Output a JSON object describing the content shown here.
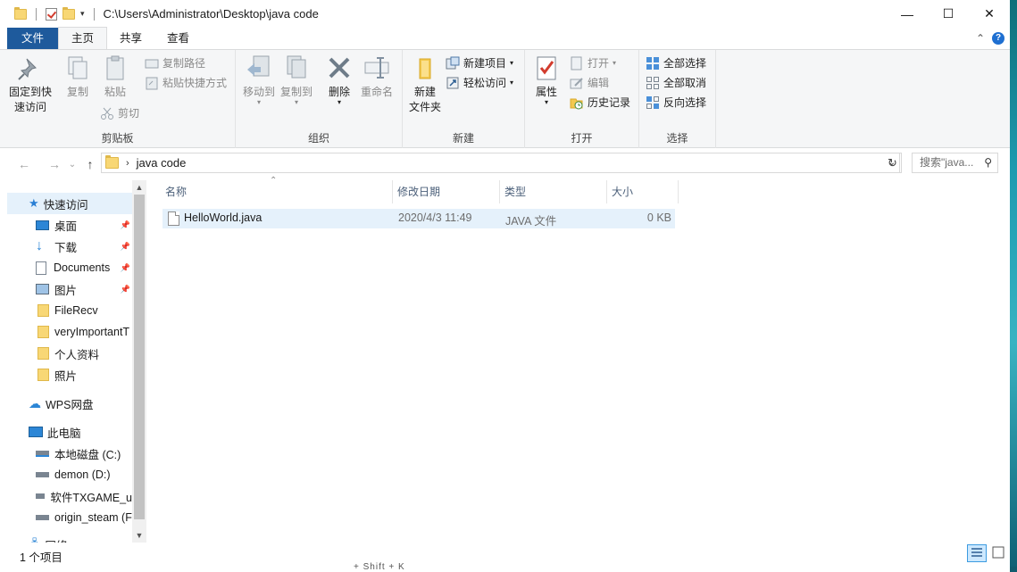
{
  "window": {
    "title_path": "C:\\Users\\Administrator\\Desktop\\java code",
    "minimize": "—",
    "maximize": "☐",
    "close": "✕"
  },
  "tabs": [
    {
      "label": "文件"
    },
    {
      "label": "主页"
    },
    {
      "label": "共享"
    },
    {
      "label": "查看"
    }
  ],
  "ribbon": {
    "clipboard": {
      "group_label": "剪贴板",
      "pin_line1": "固定到快",
      "pin_line2": "速访问",
      "copy": "复制",
      "paste": "粘贴",
      "copy_path": "复制路径",
      "paste_shortcut": "粘贴快捷方式",
      "cut": "剪切"
    },
    "organize": {
      "group_label": "组织",
      "move_to": "移动到",
      "copy_to": "复制到",
      "delete": "删除",
      "rename": "重命名"
    },
    "new": {
      "group_label": "新建",
      "new_folder_line1": "新建",
      "new_folder_line2": "文件夹",
      "new_item": "新建项目",
      "easy_access": "轻松访问"
    },
    "open": {
      "group_label": "打开",
      "properties": "属性",
      "open": "打开",
      "edit": "编辑",
      "history": "历史记录"
    },
    "select": {
      "group_label": "选择",
      "select_all": "全部选择",
      "select_none": "全部取消",
      "invert": "反向选择"
    }
  },
  "address": {
    "path": "java code",
    "search_placeholder": "搜索\"java..."
  },
  "nav": {
    "items": [
      {
        "label": "快速访问",
        "icon": "star-icon"
      },
      {
        "label": "桌面",
        "icon": "desktop-icon",
        "pinned": true
      },
      {
        "label": "下载",
        "icon": "download-icon",
        "pinned": true
      },
      {
        "label": "Documents",
        "icon": "document-icon",
        "pinned": true
      },
      {
        "label": "图片",
        "icon": "picture-icon",
        "pinned": true
      },
      {
        "label": "FileRecv",
        "icon": "folder-icon"
      },
      {
        "label": "veryImportantT",
        "icon": "folder-icon"
      },
      {
        "label": "个人资料",
        "icon": "folder-icon"
      },
      {
        "label": "照片",
        "icon": "folder-icon"
      },
      {
        "label": "WPS网盘",
        "icon": "cloud-icon"
      },
      {
        "label": "此电脑",
        "icon": "computer-icon"
      },
      {
        "label": "本地磁盘 (C:)",
        "icon": "drive-icon"
      },
      {
        "label": "demon (D:)",
        "icon": "drive-icon"
      },
      {
        "label": "软件TXGAME_u",
        "icon": "drive-icon"
      },
      {
        "label": "origin_steam (F",
        "icon": "drive-icon"
      },
      {
        "label": "网络",
        "icon": "network-icon"
      }
    ]
  },
  "columns": {
    "name": "名称",
    "modified": "修改日期",
    "type": "类型",
    "size": "大小"
  },
  "files": [
    {
      "name": "HelloWorld.java",
      "modified": "2020/4/3 11:49",
      "type": "JAVA 文件",
      "size": "0 KB"
    }
  ],
  "status": {
    "count": "1 个项目",
    "hint": "+ Shift + K"
  }
}
